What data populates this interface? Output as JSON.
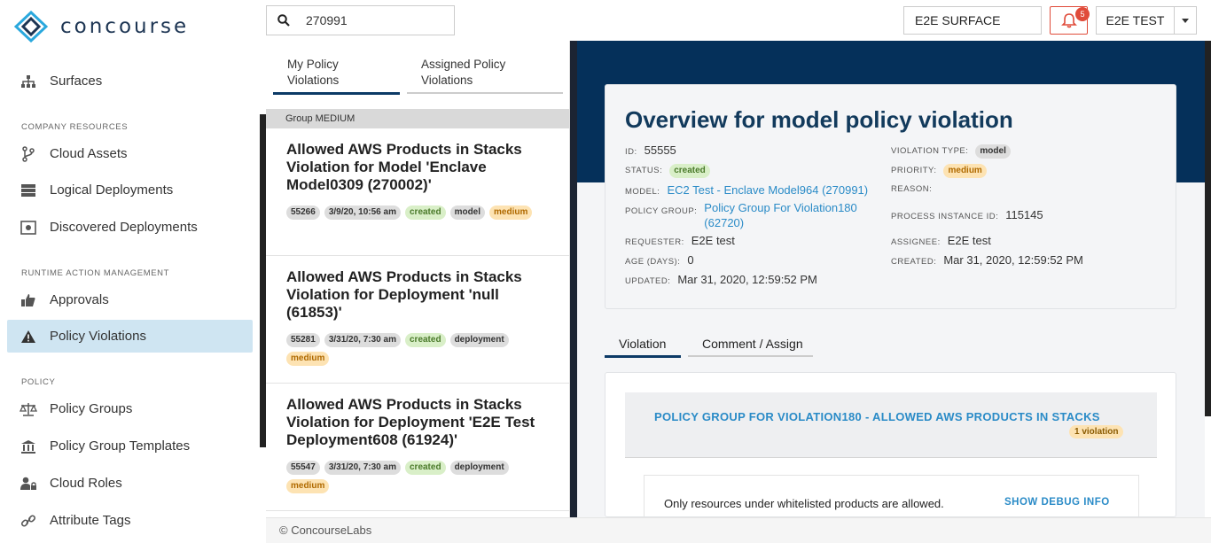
{
  "app": {
    "name": "concourse"
  },
  "search": {
    "value": "270991"
  },
  "topbar": {
    "surface": "E2E SURFACE",
    "notifications": "5",
    "user": "E2E TEST"
  },
  "sidebar": {
    "surfaces": "Surfaces",
    "section_company": "COMPANY RESOURCES",
    "cloud_assets": "Cloud Assets",
    "logical_deployments": "Logical Deployments",
    "discovered_deployments": "Discovered Deployments",
    "section_runtime": "RUNTIME ACTION MANAGEMENT",
    "approvals": "Approvals",
    "policy_violations": "Policy Violations",
    "section_policy": "POLICY",
    "policy_groups": "Policy Groups",
    "policy_group_templates": "Policy Group Templates",
    "cloud_roles": "Cloud Roles",
    "attribute_tags": "Attribute Tags"
  },
  "list": {
    "tabs": [
      {
        "line1": "My Policy",
        "line2": "Violations"
      },
      {
        "line1": "Assigned Policy",
        "line2": "Violations"
      }
    ],
    "group_header": "Group MEDIUM",
    "items": [
      {
        "title": "Allowed AWS Products in Stacks Violation for Model 'Enclave Model0309 (270002)'",
        "id": "55266",
        "date": "3/9/20, 10:56 am",
        "status": "created",
        "type": "model",
        "priority": "medium"
      },
      {
        "title": "Allowed AWS Products in Stacks Violation for Deployment 'null (61853)'",
        "id": "55281",
        "date": "3/31/20, 7:30 am",
        "status": "created",
        "type": "deployment",
        "priority": "medium"
      },
      {
        "title": "Allowed AWS Products in Stacks Violation for Deployment 'E2E Test Deployment608 (61924)'",
        "id": "55547",
        "date": "3/31/20, 7:30 am",
        "status": "created",
        "type": "deployment",
        "priority": "medium"
      }
    ]
  },
  "overview": {
    "title": "Overview for model policy violation",
    "id_label": "ID:",
    "id": "55555",
    "status_label": "STATUS:",
    "status": "created",
    "model_label": "MODEL:",
    "model": "EC2 Test - Enclave Model964 (270991)",
    "policy_group_label": "POLICY GROUP:",
    "policy_group_1": "Policy Group For Violation180",
    "policy_group_2": "(62720)",
    "requester_label": "REQUESTER:",
    "requester": "E2E test",
    "age_label": "AGE (DAYS):",
    "age": "0",
    "updated_label": "UPDATED:",
    "updated": "Mar 31, 2020, 12:59:52 PM",
    "violation_type_label": "VIOLATION TYPE:",
    "violation_type": "model",
    "priority_label": "PRIORITY:",
    "priority": "medium",
    "reason_label": "REASON:",
    "process_label": "PROCESS INSTANCE ID:",
    "process_id": "115145",
    "assignee_label": "ASSIGNEE:",
    "assignee": "E2E test",
    "created_label": "CREATED:",
    "created": "Mar 31, 2020, 12:59:52 PM"
  },
  "detail_tabs": {
    "violation": "Violation",
    "comment": "Comment / Assign"
  },
  "violation": {
    "group_title": "POLICY GROUP FOR VIOLATION180 - ALLOWED AWS PRODUCTS IN STACKS",
    "count": "1 violation",
    "rule_text": "Only resources under whitelisted products are allowed.",
    "debug": "SHOW DEBUG INFO"
  },
  "footer": {
    "text": "© ConcourseLabs"
  },
  "colors": {
    "navy": "#05305a",
    "link": "#2a8bc7",
    "active_nav": "#cfe5f2",
    "alert": "#e04b3a"
  }
}
